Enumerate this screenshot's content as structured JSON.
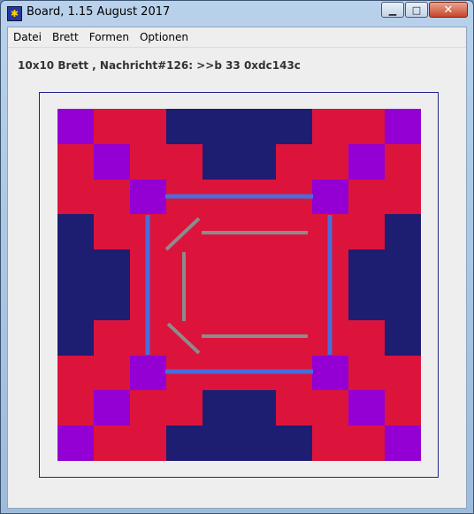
{
  "window": {
    "title": "Board, 1.15 August 2017",
    "buttons": {
      "minimize": "▁",
      "maximize": "□",
      "close": "✕"
    }
  },
  "menu": [
    {
      "label": "Datei"
    },
    {
      "label": "Brett"
    },
    {
      "label": "Formen"
    },
    {
      "label": "Optionen"
    }
  ],
  "status": "10x10 Brett , Nachricht#126: >>b 33 0xdc143c",
  "colors": {
    "board_bg": "#dc143c",
    "navy": "#1d1d72",
    "violet": "#9400d3",
    "line_blue": "#4a6ddc",
    "line_gray": "#8c8c8c",
    "frame": "#23238e"
  },
  "board": {
    "size": 10,
    "cells": [
      "VRRNNNNRRV",
      "RVRRNNRRVR",
      "RRVRRRRVRR",
      "NRRRRRRRRN",
      "NNRRRRRRNN",
      "NNRRRRRRNN",
      "NRRRRRRRRN",
      "RRVRRRRVRR",
      "RVRRNNRRVR",
      "VRRNNNNRRV"
    ]
  }
}
